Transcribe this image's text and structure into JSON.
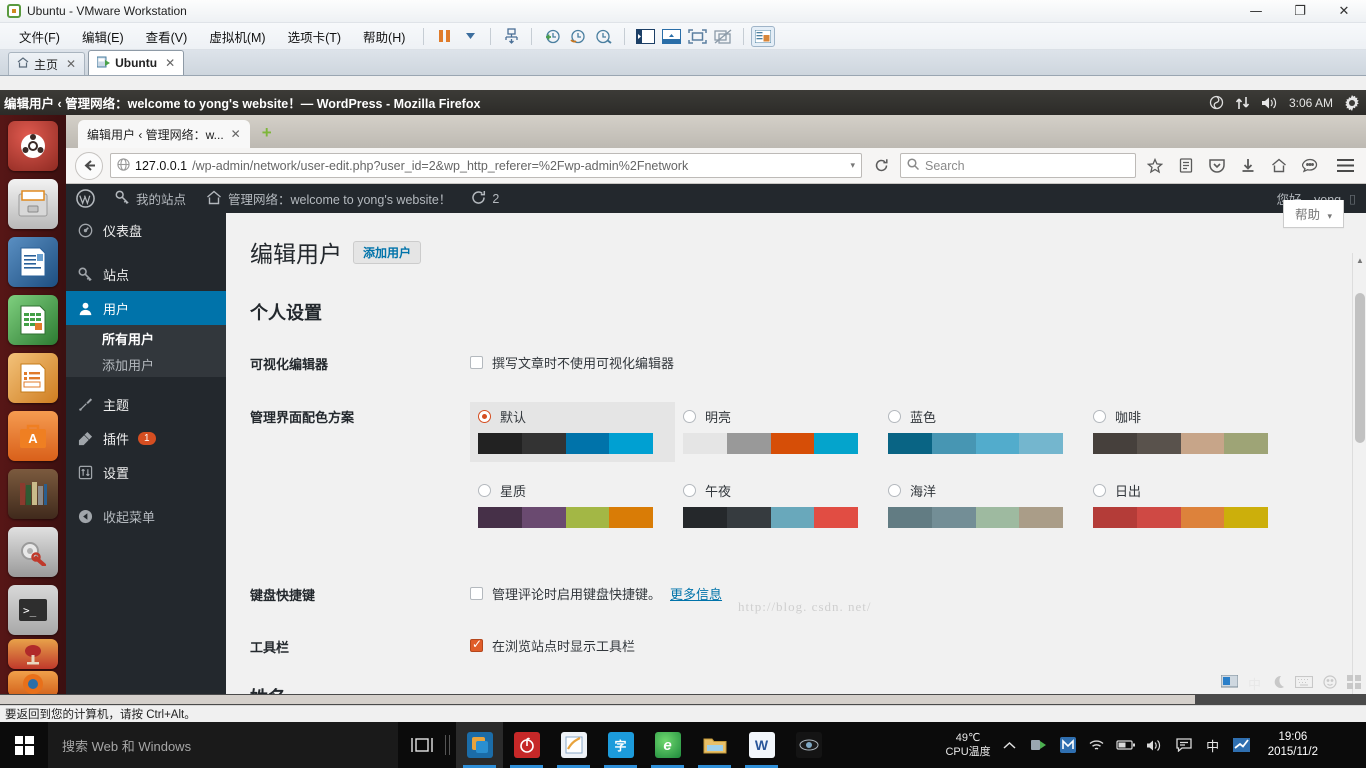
{
  "vmware": {
    "title": "Ubuntu - VMware Workstation",
    "menu": [
      {
        "label": "文件(F)"
      },
      {
        "label": "编辑(E)"
      },
      {
        "label": "查看(V)"
      },
      {
        "label": "虚拟机(M)"
      },
      {
        "label": "选项卡(T)"
      },
      {
        "label": "帮助(H)"
      }
    ],
    "toolbar_icons": [
      "pause-icon",
      "dropdown-caret-icon",
      "snapshot-manager-icon",
      "take-snapshot-icon",
      "revert-snapshot-icon",
      "manage-snapshot-icon",
      "show-library-icon",
      "show-thumbnail-bar-icon",
      "full-screen-icon",
      "unity-mode-icon",
      "console-view-icon"
    ],
    "window_buttons": {
      "minimize": "—",
      "maximize": "❐",
      "close": "✕"
    },
    "tabs": [
      {
        "label": "主页",
        "icon": "home-icon",
        "active": false
      },
      {
        "label": "Ubuntu",
        "icon": "vm-icon",
        "active": true
      }
    ],
    "status_text": "要返回到您的计算机，请按 Ctrl+Alt。"
  },
  "ubuntu": {
    "window_title": "编辑用户 ‹ 管理网络：welcome to yong's website！— WordPress - Mozilla Firefox",
    "panel_indicators": [
      "sync-icon",
      "network-updown-icon",
      "volume-icon"
    ],
    "clock": "3:06 AM",
    "gear_icon": "gear-icon",
    "launcher_items": [
      {
        "name": "ubuntu-dash-icon",
        "color1": "#d24a42",
        "color2": "#8c2420",
        "glyph": "◉"
      },
      {
        "name": "files-icon",
        "color1": "#e8e8e8",
        "color2": "#b4b4b4",
        "glyph": "🗄"
      },
      {
        "name": "libreoffice-writer-icon",
        "color1": "#2a6099",
        "color2": "#1a4570",
        "glyph": "📄"
      },
      {
        "name": "libreoffice-calc-icon",
        "color1": "#43a047",
        "color2": "#2e7031",
        "glyph": "▦"
      },
      {
        "name": "libreoffice-impress-icon",
        "color1": "#e8a33d",
        "color2": "#c47b18",
        "glyph": "▤"
      },
      {
        "name": "ubuntu-software-center-icon",
        "color1": "#f08437",
        "color2": "#d2601a",
        "glyph": "A"
      },
      {
        "name": "amazon-bookshelf-icon",
        "color1": "#6b4a35",
        "color2": "#3d2a1e",
        "glyph": "▮"
      },
      {
        "name": "system-settings-icon",
        "color1": "#d0d0d0",
        "color2": "#9a9a9a",
        "glyph": "⚙"
      },
      {
        "name": "terminal-icon",
        "color1": "#3a3a3a",
        "color2": "#111111",
        "glyph": ">_"
      },
      {
        "name": "wine-icon",
        "color1": "#c0392b",
        "color2": "#7b1f15",
        "glyph": "🍷"
      },
      {
        "name": "firefox-icon",
        "color1": "#e8701a",
        "color2": "#c04a10",
        "glyph": "◯"
      }
    ],
    "ime_indicators": [
      "screen-icon",
      "chinese-mode-icon",
      "moon-icon",
      "keyboard-icon",
      "emoji-icon",
      "grid-icon"
    ]
  },
  "firefox": {
    "tab_label": "编辑用户 ‹ 管理网络：w...",
    "tab_close": "✕",
    "new_tab": "+",
    "back_icon": "back-arrow-icon",
    "url_host": "127.0.0.1",
    "url_path": "/wp-admin/network/user-edit.php?user_id=2&wp_http_referer=%2Fwp-admin%2Fnetwork",
    "url_dropdown": "▾",
    "reload_icon": "reload-icon",
    "search_placeholder": "Search",
    "search_icon": "search-icon",
    "toolbar_icons": [
      "bookmark-star-icon",
      "reader-list-icon",
      "pocket-icon",
      "downloads-icon",
      "home-icon",
      "sync-chat-icon",
      "hamburger-menu-icon"
    ]
  },
  "wordpress": {
    "adminbar": {
      "logo": "wordpress-logo-icon",
      "my_sites": "我的站点",
      "my_sites_icon": "key-icon",
      "network_label": "管理网络：welcome to yong's website！",
      "network_icon": "home-icon",
      "updates_icon": "updates-icon",
      "updates_count": "2",
      "greeting": "您好，yong"
    },
    "sidebar": [
      {
        "label": "仪表盘",
        "icon": "dashboard-icon",
        "current": false
      },
      {
        "label": "站点",
        "icon": "key-icon",
        "current": false,
        "gap": true
      },
      {
        "label": "用户",
        "icon": "user-icon",
        "current": true
      },
      {
        "label": "主题",
        "icon": "appearance-icon",
        "current": false,
        "gap": true
      },
      {
        "label": "插件",
        "icon": "plugins-icon",
        "current": false,
        "badge": "1"
      },
      {
        "label": "设置",
        "icon": "settings-icon",
        "current": false
      },
      {
        "label": "收起菜单",
        "icon": "collapse-icon",
        "current": false,
        "gap": true
      }
    ],
    "submenu": [
      {
        "label": "所有用户",
        "current": true
      },
      {
        "label": "添加用户",
        "current": false
      }
    ],
    "help_tab": "帮助",
    "help_caret": "▾",
    "page_title": "编辑用户",
    "add_user_button": "添加用户",
    "section_title": "个人设置",
    "fields": {
      "visual_editor": {
        "label": "可视化编辑器",
        "checkbox_label": "撰写文章时不使用可视化编辑器",
        "checked": false
      },
      "color_scheme": {
        "label": "管理界面配色方案"
      },
      "keyboard_shortcuts": {
        "label": "键盘快捷键",
        "checkbox_label": "管理评论时启用键盘快捷键。",
        "link": "更多信息",
        "checked": false
      },
      "toolbar": {
        "label": "工具栏",
        "checkbox_label": "在浏览站点时显示工具栏",
        "checked": true
      },
      "next_label": "姓名"
    },
    "color_schemes": [
      {
        "name": "默认",
        "selected": true,
        "colors": [
          "#222222",
          "#333333",
          "#0073aa",
          "#00a0d2"
        ]
      },
      {
        "name": "明亮",
        "selected": false,
        "colors": [
          "#e5e5e5",
          "#999999",
          "#d64e07",
          "#04a4cc"
        ]
      },
      {
        "name": "蓝色",
        "selected": false,
        "colors": [
          "#096484",
          "#4796b3",
          "#52accc",
          "#74B6CE"
        ]
      },
      {
        "name": "咖啡",
        "selected": false,
        "colors": [
          "#46403c",
          "#59524c",
          "#c7a589",
          "#9ea476"
        ]
      },
      {
        "name": "星质",
        "selected": false,
        "colors": [
          "#463048",
          "#6a4a70",
          "#a3b745",
          "#d97c06"
        ]
      },
      {
        "name": "午夜",
        "selected": false,
        "colors": [
          "#25282b",
          "#363b3f",
          "#69a8bb",
          "#e14d43"
        ]
      },
      {
        "name": "海洋",
        "selected": false,
        "colors": [
          "#627c83",
          "#738e96",
          "#9ebaa0",
          "#aa9d88"
        ]
      },
      {
        "name": "日出",
        "selected": false,
        "colors": [
          "#b43c38",
          "#cf4944",
          "#dd823b",
          "#ccaf0b"
        ]
      }
    ],
    "watermark": "http://blog. csdn. net/"
  },
  "taskbar": {
    "search_placeholder": "搜索 Web 和 Windows",
    "start_icon": "windows-start-icon",
    "task_view_icon": "task-view-icon",
    "apps": [
      {
        "name": "vmware-workstation-icon",
        "glyph": "▣",
        "bg": "#1b6ca8",
        "fg": "#f0a030",
        "running": true,
        "active": true
      },
      {
        "name": "netease-music-icon",
        "glyph": "♫",
        "bg": "#c62828",
        "fg": "#ffffff",
        "running": true
      },
      {
        "name": "notepad-icon",
        "glyph": "✎",
        "bg": "#eef2f7",
        "fg": "#d48a20",
        "running": true
      },
      {
        "name": "qq-pinyin-icon",
        "glyph": "字",
        "bg": "#1c9bdb",
        "fg": "#ffffff",
        "running": true
      },
      {
        "name": "edge-browser-icon",
        "glyph": "e",
        "bg": "#2aa84a",
        "fg": "#ffffff",
        "running": true
      },
      {
        "name": "file-explorer-icon",
        "glyph": "🗀",
        "bg": "#e8c069",
        "fg": "#6a4a10",
        "running": true
      },
      {
        "name": "word-icon",
        "glyph": "W",
        "bg": "#f2f6fb",
        "fg": "#2b579a",
        "running": true
      },
      {
        "name": "virtual-dj-icon",
        "glyph": "◉",
        "bg": "#161616",
        "fg": "#cfd8dc",
        "running": false
      }
    ],
    "tray": {
      "expand_icon": "show-hidden-icons-icon",
      "icons": [
        "green-shield-icon",
        "maxthon-icon",
        "wifi-icon",
        "battery-icon",
        "volume-icon",
        "action-center-icon",
        "ime-chinese-icon",
        "mail-icon"
      ],
      "ime_label": "中",
      "cpu_temp": "49℃",
      "cpu_temp_label": "CPU温度",
      "time": "19:06",
      "date": "2015/11/2"
    }
  }
}
